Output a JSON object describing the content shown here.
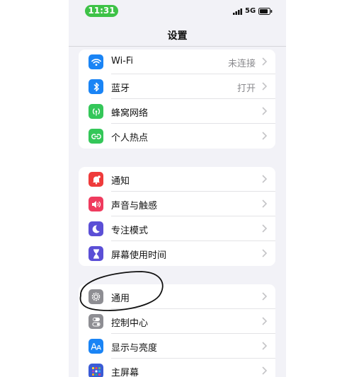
{
  "status_bar": {
    "time": "11:31",
    "network": "5G"
  },
  "nav": {
    "title": "设置"
  },
  "groups": [
    {
      "items": [
        {
          "label": "Wi-Fi",
          "value": "未连接",
          "icon": "wifi-icon",
          "color": "#1a84f5"
        },
        {
          "label": "蓝牙",
          "value": "打开",
          "icon": "bluetooth-icon",
          "color": "#1a84f5"
        },
        {
          "label": "蜂窝网络",
          "value": "",
          "icon": "cellular-icon",
          "color": "#34c759"
        },
        {
          "label": "个人热点",
          "value": "",
          "icon": "hotspot-icon",
          "color": "#34c759"
        }
      ]
    },
    {
      "items": [
        {
          "label": "通知",
          "value": "",
          "icon": "notifications-icon",
          "color": "#ef3b3b"
        },
        {
          "label": "声音与触感",
          "value": "",
          "icon": "sound-icon",
          "color": "#ef3b5e"
        },
        {
          "label": "专注模式",
          "value": "",
          "icon": "moon-icon",
          "color": "#5b4fd6"
        },
        {
          "label": "屏幕使用时间",
          "value": "",
          "icon": "hourglass-icon",
          "color": "#5b4fd6"
        }
      ]
    },
    {
      "items": [
        {
          "label": "通用",
          "value": "",
          "icon": "gear-icon",
          "color": "#8e8e93"
        },
        {
          "label": "控制中心",
          "value": "",
          "icon": "toggles-icon",
          "color": "#8e8e93"
        },
        {
          "label": "显示与亮度",
          "value": "",
          "icon": "display-icon",
          "color": "#1a84f5"
        },
        {
          "label": "主屏幕",
          "value": "",
          "icon": "home-screen-icon",
          "color": "#3a5bd6"
        }
      ]
    }
  ]
}
